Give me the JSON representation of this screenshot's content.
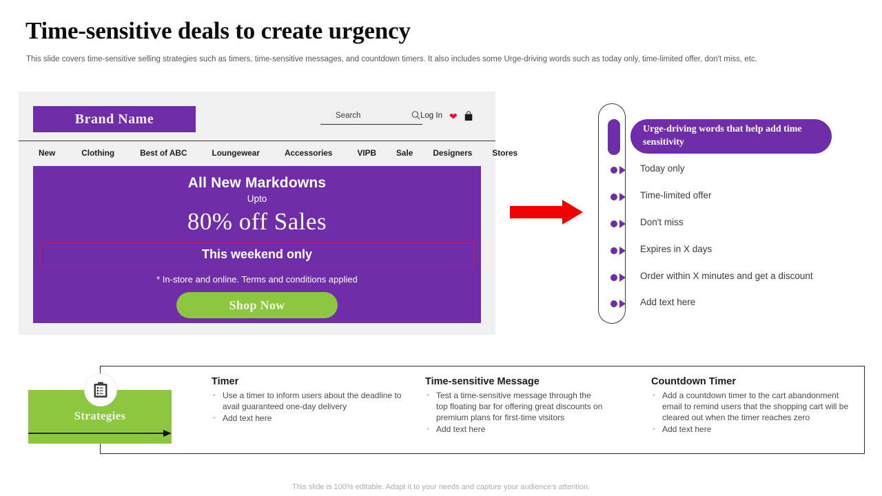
{
  "header": {
    "title": "Time-sensitive deals to create urgency",
    "subtitle": "This slide covers time-sensitive selling strategies such as timers, time-sensitive messages, and countdown timers. It also includes some Urge-driving words such as today only, time-limited offer, don't miss, etc."
  },
  "colors": {
    "purple": "#6F2DA8",
    "green": "#8DC63F",
    "red_arrow": "#F20000",
    "highlight_border": "#C8175A",
    "panel_bg": "#F0F0F0",
    "heart_red": "#E8112D"
  },
  "website": {
    "brand_name": "Brand Name",
    "search": {
      "placeholder": "Search",
      "icon": "search-icon"
    },
    "login_label": "Log In",
    "wishlist_icon": "heart-icon",
    "cart_icon": "shopping-bag-icon",
    "nav_items": [
      "New",
      "Clothing",
      "Best of ABC",
      "Loungewear",
      "Accessories",
      "VIPB",
      "Sale",
      "Designers",
      "Stores"
    ],
    "banner": {
      "headline": "All New Markdowns",
      "upto": "Upto",
      "offer": "80% off Sales",
      "highlight": "This weekend only",
      "terms": "* In-store and online. Terms and conditions applied",
      "cta_label": "Shop Now"
    }
  },
  "urge_panel": {
    "badge_title": "Urge-driving words that help add time sensitivity",
    "items": [
      "Today only",
      "Time-limited offer",
      "Don't miss",
      "Expires in X days",
      "Order within X minutes and get a discount",
      "Add text here"
    ]
  },
  "strategies": {
    "box_label": "Strategies",
    "box_icon": "clipboard-icon",
    "columns": [
      {
        "title": "Timer",
        "bullets": [
          "Use a timer to inform users about the deadline to avail guaranteed one-day delivery",
          "Add text here"
        ]
      },
      {
        "title": "Time-sensitive Message",
        "bullets": [
          "Test a time-sensitive message through the top floating bar for offering great discounts on premium plans for first-time visitors",
          "Add text here"
        ]
      },
      {
        "title": "Countdown Timer",
        "bullets": [
          "Add a countdown timer to the cart abandonment email to remind users that the shopping cart will be cleared out when the timer reaches zero",
          "Add text here"
        ]
      }
    ]
  },
  "footer": {
    "note": "This slide is 100% editable. Adapt it to your needs and capture your audience's attention."
  }
}
